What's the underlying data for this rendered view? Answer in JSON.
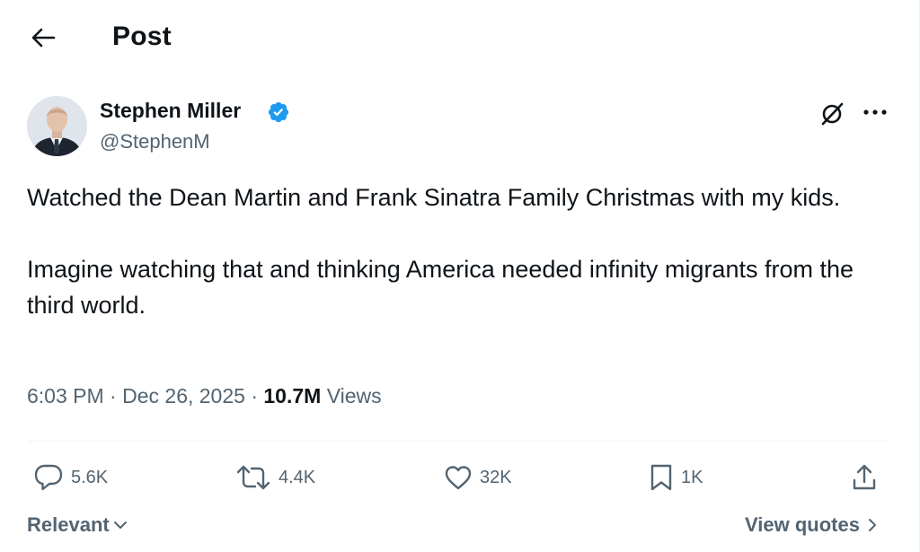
{
  "header": {
    "title": "Post",
    "back_icon": "arrow-left-icon"
  },
  "author": {
    "name": "Stephen Miller",
    "handle": "@StephenM",
    "verified": true,
    "verified_color": "#1d9bf0"
  },
  "post": {
    "paragraphs": [
      "Watched the Dean Martin and Frank Sinatra Family Christmas with my kids.",
      "Imagine watching that and thinking America needed infinity migrants from the third world."
    ],
    "time": "6:03 PM",
    "separator": "·",
    "date": "Dec 26, 2025",
    "views_count": "10.7M",
    "views_label": "Views"
  },
  "actions": {
    "replies": "5.6K",
    "reposts": "4.4K",
    "likes": "32K",
    "bookmarks": "1K"
  },
  "footer": {
    "sort_label": "Relevant",
    "quotes_label": "View quotes"
  },
  "colors": {
    "text": "#0f1419",
    "secondary": "#536471",
    "accent": "#1d9bf0",
    "divider": "#eff3f4"
  }
}
